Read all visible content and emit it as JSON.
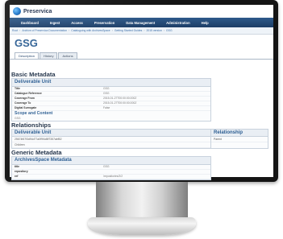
{
  "app": {
    "logo_text": "Preservica"
  },
  "nav": [
    "Dashboard",
    "Ingest",
    "Access",
    "Preservation",
    "Data Management",
    "Administration",
    "Help"
  ],
  "breadcrumb": [
    "Root",
    "Archive of Preservica Documentation",
    "Cataloguing with ArchivesSpace",
    "Getting Started Guides",
    "2015 version",
    "GSG"
  ],
  "page_title": "GSG",
  "tabs": [
    "Description",
    "History",
    "Actions"
  ],
  "basic_metadata": {
    "heading": "Basic Metadata",
    "panel_title": "Deliverable Unit",
    "rows": [
      {
        "key": "Title",
        "value": "GSG"
      },
      {
        "key": "Catalogue Reference",
        "value": "GSG"
      },
      {
        "key": "Coverage From",
        "value": "2015-01-27T00:00:00.000Z"
      },
      {
        "key": "Coverage To",
        "value": "2015-01-27T00:00:00.000Z"
      },
      {
        "key": "Digital Surrogate",
        "value": "False"
      }
    ],
    "scope_heading": "Scope and Content",
    "scope_value": "GSG"
  },
  "relationships": {
    "heading": "Relationships",
    "left_title": "Deliverable Unit",
    "right_title": "Relationship",
    "left_value": "25674f67f3d94d77a0f9f4d5f7357abf52",
    "right_value": "Parent",
    "extra_value": "Children"
  },
  "generic_metadata": {
    "heading": "Generic Metadata",
    "panel_title": "ArchivesSpace Metadata",
    "rows": [
      {
        "key": "title",
        "value": "GSG"
      },
      {
        "key": "repository",
        "value": ""
      },
      {
        "key": "ref",
        "value": "/repositories/2/2"
      }
    ]
  }
}
